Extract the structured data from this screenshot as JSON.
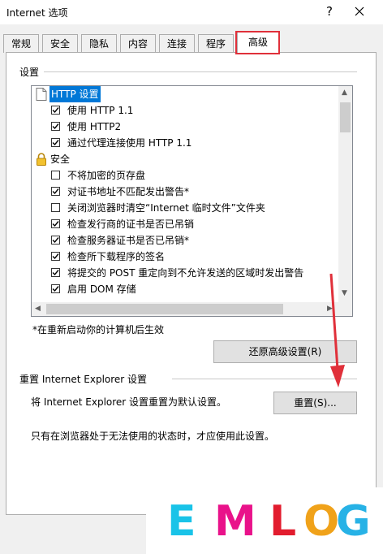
{
  "window": {
    "title": "Internet 选项",
    "help": "?",
    "close": "✕"
  },
  "tabs": [
    {
      "label": "常规"
    },
    {
      "label": "安全"
    },
    {
      "label": "隐私"
    },
    {
      "label": "内容"
    },
    {
      "label": "连接"
    },
    {
      "label": "程序"
    },
    {
      "label": "高级"
    }
  ],
  "settings": {
    "group_label": "设置",
    "items": [
      {
        "type": "category",
        "label": "HTTP 设置",
        "icon": "page-icon",
        "selected": true
      },
      {
        "type": "checkbox",
        "label": "使用 HTTP 1.1",
        "checked": true
      },
      {
        "type": "checkbox",
        "label": "使用 HTTP2",
        "checked": true
      },
      {
        "type": "checkbox",
        "label": "通过代理连接使用 HTTP 1.1",
        "checked": true
      },
      {
        "type": "category",
        "label": "安全",
        "icon": "lock-icon"
      },
      {
        "type": "checkbox",
        "label": "不将加密的页存盘",
        "checked": false
      },
      {
        "type": "checkbox",
        "label": "对证书地址不匹配发出警告*",
        "checked": true
      },
      {
        "type": "checkbox",
        "label": "关闭浏览器时清空“Internet 临时文件”文件夹",
        "checked": false
      },
      {
        "type": "checkbox",
        "label": "检查发行商的证书是否已吊销",
        "checked": true
      },
      {
        "type": "checkbox",
        "label": "检查服务器证书是否已吊销*",
        "checked": true
      },
      {
        "type": "checkbox",
        "label": "检查所下载程序的签名",
        "checked": true
      },
      {
        "type": "checkbox",
        "label": "将提交的 POST 重定向到不允许发送的区域时发出警告",
        "checked": true
      },
      {
        "type": "checkbox",
        "label": "启用 DOM 存储",
        "checked": true
      }
    ],
    "footnote": "*在重新启动你的计算机后生效",
    "restore_button": "还原高级设置(R)"
  },
  "reset": {
    "group_label": "重置 Internet Explorer 设置",
    "description": "将 Internet Explorer 设置重置为默认设置。",
    "button": "重置(S)...",
    "hint": "只有在浏览器处于无法使用的状态时，才应使用此设置。"
  },
  "watermark": {
    "letters": [
      "E",
      "M",
      "L",
      "O",
      "G"
    ],
    "colors": [
      "#19c3e8",
      "#e9128a",
      "#e21c2e",
      "#f0a21a",
      "#27b2e6"
    ]
  },
  "colors": {
    "selection": "#0078d7",
    "highlight_box": "#e0303a",
    "arrow": "#e0303a"
  }
}
